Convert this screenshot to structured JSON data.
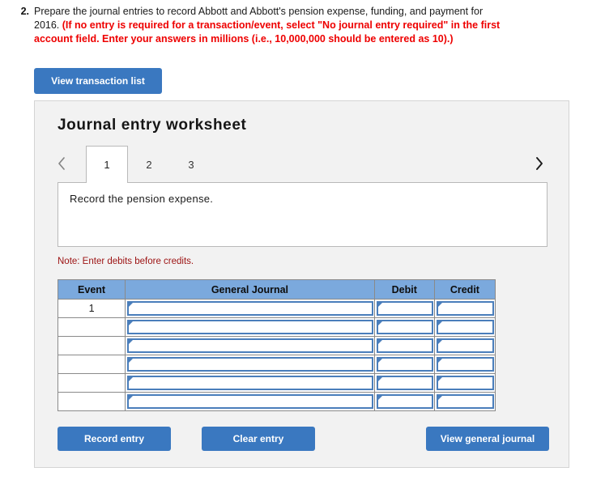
{
  "question": {
    "number": "2.",
    "text_main": "Prepare the journal entries to record Abbott and Abbott's pension expense, funding, and payment for 2016. ",
    "text_emphasis": "(If no entry is required for a transaction/event, select \"No journal entry required\" in the first account field. Enter your answers in millions (i.e., 10,000,000 should be entered as 10).)"
  },
  "toolbar": {
    "view_transaction_list_label": "View transaction list"
  },
  "worksheet": {
    "title": "Journal entry worksheet",
    "prev_icon": "chevron-left-icon",
    "next_icon": "chevron-right-icon",
    "tabs": [
      {
        "label": "1",
        "active": true
      },
      {
        "label": "2",
        "active": false
      },
      {
        "label": "3",
        "active": false
      }
    ],
    "instruction": "Record the pension expense.",
    "note": "Note: Enter debits before credits.",
    "table": {
      "headers": [
        "Event",
        "General Journal",
        "Debit",
        "Credit"
      ],
      "rows": [
        {
          "event": "1",
          "general_journal": "",
          "debit": "",
          "credit": ""
        },
        {
          "event": "",
          "general_journal": "",
          "debit": "",
          "credit": ""
        },
        {
          "event": "",
          "general_journal": "",
          "debit": "",
          "credit": ""
        },
        {
          "event": "",
          "general_journal": "",
          "debit": "",
          "credit": ""
        },
        {
          "event": "",
          "general_journal": "",
          "debit": "",
          "credit": ""
        },
        {
          "event": "",
          "general_journal": "",
          "debit": "",
          "credit": ""
        }
      ]
    },
    "buttons": {
      "record_entry": "Record entry",
      "clear_entry": "Clear entry",
      "view_general_journal": "View general journal"
    }
  },
  "colors": {
    "button_blue": "#3a78c0",
    "table_header_blue": "#7ba9dd",
    "input_border_blue": "#4a7ebb",
    "emphasis_red": "#ee0000",
    "note_red": "#9c1111",
    "panel_gray": "#f2f2f2"
  }
}
